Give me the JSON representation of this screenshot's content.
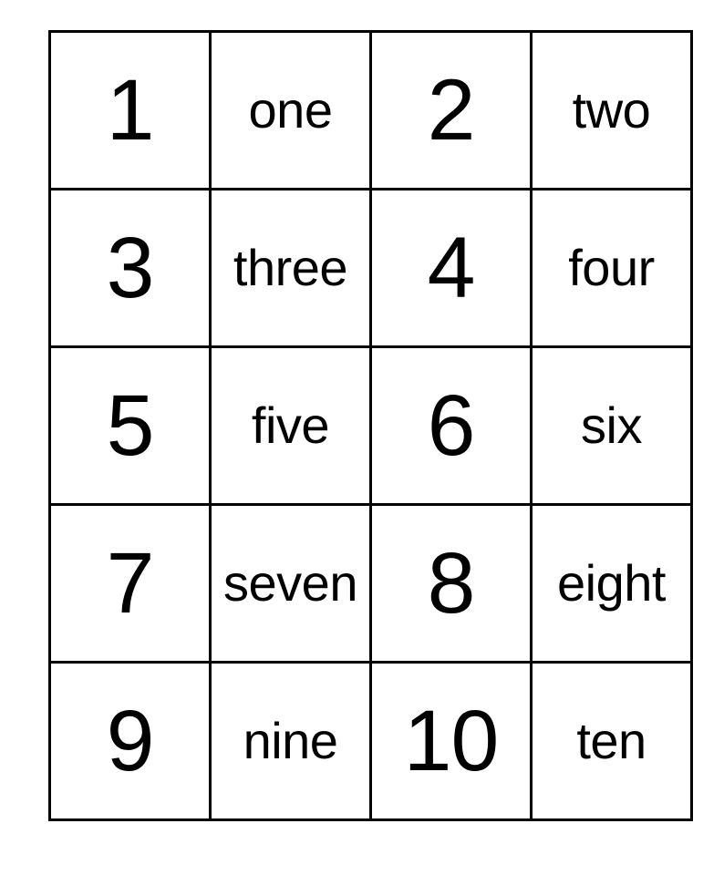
{
  "page": {
    "background_color": "#ffffff",
    "ink_color": "#000000",
    "border_color": "#000000"
  },
  "grid": {
    "columns": 4,
    "rows": 5,
    "column_kinds": [
      "numeral",
      "word",
      "numeral",
      "word"
    ],
    "cells": [
      [
        {
          "kind": "numeral",
          "text": "1"
        },
        {
          "kind": "word",
          "text": "one"
        },
        {
          "kind": "numeral",
          "text": "2"
        },
        {
          "kind": "word",
          "text": "two"
        }
      ],
      [
        {
          "kind": "numeral",
          "text": "3"
        },
        {
          "kind": "word",
          "text": "three"
        },
        {
          "kind": "numeral",
          "text": "4"
        },
        {
          "kind": "word",
          "text": "four"
        }
      ],
      [
        {
          "kind": "numeral",
          "text": "5"
        },
        {
          "kind": "word",
          "text": "five"
        },
        {
          "kind": "numeral",
          "text": "6"
        },
        {
          "kind": "word",
          "text": "six"
        }
      ],
      [
        {
          "kind": "numeral",
          "text": "7"
        },
        {
          "kind": "word",
          "text": "seven"
        },
        {
          "kind": "numeral",
          "text": "8"
        },
        {
          "kind": "word",
          "text": "eight"
        }
      ],
      [
        {
          "kind": "numeral",
          "text": "9"
        },
        {
          "kind": "word",
          "text": "nine"
        },
        {
          "kind": "numeral",
          "text": "10"
        },
        {
          "kind": "word",
          "text": "ten"
        }
      ]
    ]
  }
}
